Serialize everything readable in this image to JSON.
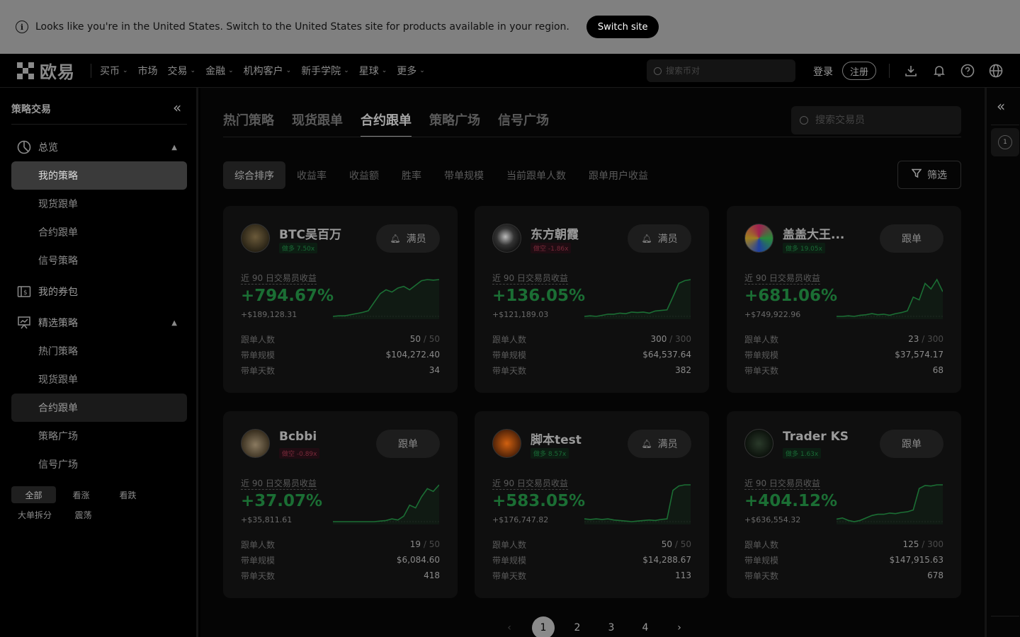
{
  "banner": {
    "message": "Looks like you're in the United States. Switch to the United States site for products available in your region.",
    "button": "Switch site"
  },
  "topnav": {
    "brand": "欧易",
    "items": [
      {
        "label": "买币",
        "dropdown": true
      },
      {
        "label": "市场",
        "dropdown": false
      },
      {
        "label": "交易",
        "dropdown": true
      },
      {
        "label": "金融",
        "dropdown": true
      },
      {
        "label": "机构客户",
        "dropdown": true
      },
      {
        "label": "新手学院",
        "dropdown": true
      },
      {
        "label": "星球",
        "dropdown": true
      },
      {
        "label": "更多",
        "dropdown": true
      }
    ],
    "search_placeholder": "搜索币对",
    "login": "登录",
    "register": "注册",
    "icons": [
      "download-icon",
      "bell-icon",
      "help-icon",
      "globe-icon"
    ]
  },
  "sidebar": {
    "title": "策略交易",
    "overview": "总览",
    "overview_items": [
      "我的策略",
      "现货跟单",
      "合约跟单",
      "信号策略"
    ],
    "wallet": "我的券包",
    "featured": "精选策略",
    "featured_items": [
      "热门策略",
      "现货跟单",
      "合约跟单",
      "策略广场",
      "信号广场"
    ],
    "tags": [
      "全部",
      "看涨",
      "看跌",
      "大单拆分",
      "震荡"
    ]
  },
  "main": {
    "tabs": [
      "热门策略",
      "现货跟单",
      "合约跟单",
      "策略广场",
      "信号广场"
    ],
    "active_tab": "合约跟单",
    "search_placeholder": "搜索交易员",
    "sorts": [
      "综合排序",
      "收益率",
      "收益额",
      "胜率",
      "带单规模",
      "当前跟单人数",
      "跟单用户收益"
    ],
    "filter": "筛选",
    "pnl_label": "近 90 日交易员收益",
    "stat_labels": [
      "跟单人数",
      "带单规模",
      "带单天数"
    ],
    "cards": [
      {
        "name": "BTC吴百万",
        "leverage": "做多 7.50x",
        "side": "long",
        "button": "满员",
        "full": true,
        "pnl_pct": "+794.67%",
        "pnl_amt": "+$189,128.31",
        "followers": "50",
        "followers_max": "/ 50",
        "aum": "$104,272.40",
        "days": "34",
        "spark": [
          5,
          6,
          6,
          8,
          10,
          12,
          15,
          30,
          45,
          52,
          48,
          55,
          58,
          52,
          60,
          68,
          70,
          69,
          70
        ]
      },
      {
        "name": "东方朝霞",
        "leverage": "做空 -1.86x",
        "side": "short",
        "button": "满员",
        "full": true,
        "pnl_pct": "+136.05%",
        "pnl_amt": "+$121,189.03",
        "followers": "300",
        "followers_max": "/ 300",
        "aum": "$64,537.64",
        "days": "382",
        "spark": [
          4,
          5,
          4,
          6,
          8,
          8,
          10,
          9,
          12,
          11,
          12,
          10,
          14,
          15,
          16,
          40,
          65,
          70,
          72
        ]
      },
      {
        "name": "盖盖大王...",
        "leverage": "做多 19.05x",
        "side": "long",
        "button": "跟单",
        "full": false,
        "pnl_pct": "+681.06%",
        "pnl_amt": "+$749,922.96",
        "followers": "23",
        "followers_max": "/ 300",
        "aum": "$37,574.17",
        "days": "68",
        "spark": [
          5,
          5,
          6,
          5,
          7,
          8,
          10,
          8,
          9,
          7,
          10,
          12,
          15,
          40,
          35,
          65,
          55,
          72,
          50
        ]
      },
      {
        "name": "Bcbbi",
        "leverage": "做空 -0.89x",
        "side": "short",
        "button": "跟单",
        "full": false,
        "pnl_pct": "+37.07%",
        "pnl_amt": "+$35,811.61",
        "followers": "19",
        "followers_max": "/ 50",
        "aum": "$6,084.60",
        "days": "418",
        "spark": [
          5,
          5,
          5,
          5,
          5,
          5,
          5,
          5,
          6,
          7,
          10,
          8,
          15,
          35,
          30,
          50,
          65,
          60,
          72
        ]
      },
      {
        "name": "脚本test",
        "leverage": "做多 8.57x",
        "side": "long",
        "button": "满员",
        "full": true,
        "pnl_pct": "+583.05%",
        "pnl_amt": "+$176,747.82",
        "followers": "50",
        "followers_max": "/ 50",
        "aum": "$14,288.67",
        "days": "113",
        "spark": [
          8,
          7,
          8,
          7,
          8,
          6,
          5,
          4,
          3,
          4,
          5,
          6,
          5,
          7,
          8,
          60,
          68,
          70,
          70
        ]
      },
      {
        "name": "Trader KS",
        "leverage": "做多 1.63x",
        "side": "long",
        "button": "跟单",
        "full": false,
        "pnl_pct": "+404.12%",
        "pnl_amt": "+$636,554.32",
        "followers": "125",
        "followers_max": "/ 300",
        "aum": "$147,915.63",
        "days": "678",
        "spark": [
          10,
          12,
          8,
          6,
          8,
          12,
          16,
          18,
          18,
          20,
          19,
          21,
          22,
          25,
          60,
          65,
          64,
          66,
          66
        ]
      }
    ],
    "pages": [
      "1",
      "2",
      "3",
      "4"
    ],
    "active_page": "1"
  },
  "colors": {
    "profit": "#1b6e34",
    "loss": "#7a2a3a",
    "overlay_banner": "#808080"
  }
}
